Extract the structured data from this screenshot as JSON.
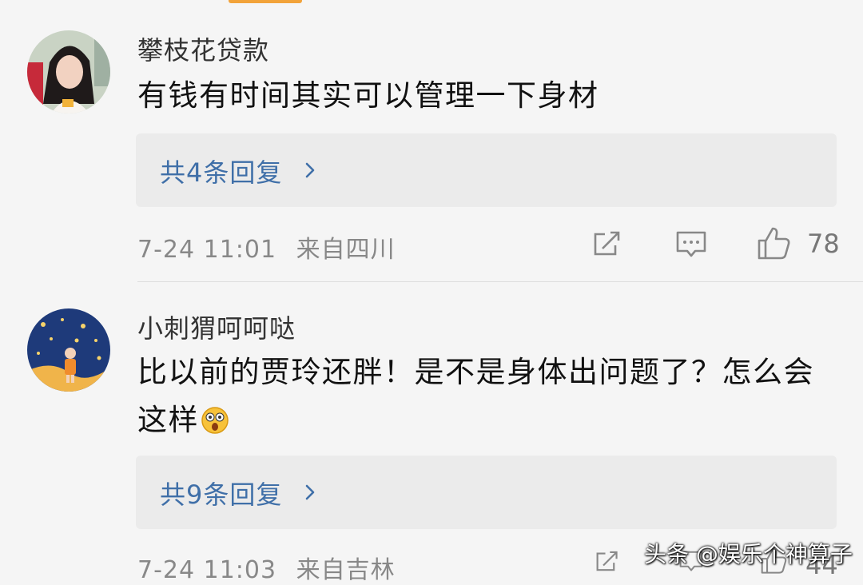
{
  "comments": [
    {
      "username": "攀枝花贷款",
      "text": "有钱有时间其实可以管理一下身材",
      "replies_label": "共4条回复",
      "date": "7-24 11:01",
      "location": "来自四川",
      "likes": "78",
      "avatar_icon": "woman-portrait-avatar"
    },
    {
      "username": "小刺猬呵呵哒",
      "text": "比以前的贾玲还胖！是不是身体出问题了？怎么会这样",
      "replies_label": "共9条回复",
      "date": "7-24 11:03",
      "location": "来自吉林",
      "likes": "44",
      "avatar_icon": "starry-night-girl-avatar",
      "emoji_icon": "shocked-face-emoji"
    }
  ],
  "icons": {
    "share": "share-icon",
    "comment": "comment-icon",
    "like": "thumbs-up-icon",
    "chevron": "chevron-right-icon"
  },
  "watermark": "头条 @娱乐个神算子",
  "colors": {
    "background": "#f5f5f5",
    "reply_box": "#ebebeb",
    "link_blue": "#3f6fa8",
    "meta_gray": "#888888",
    "top_tab": "#f2a33a"
  }
}
